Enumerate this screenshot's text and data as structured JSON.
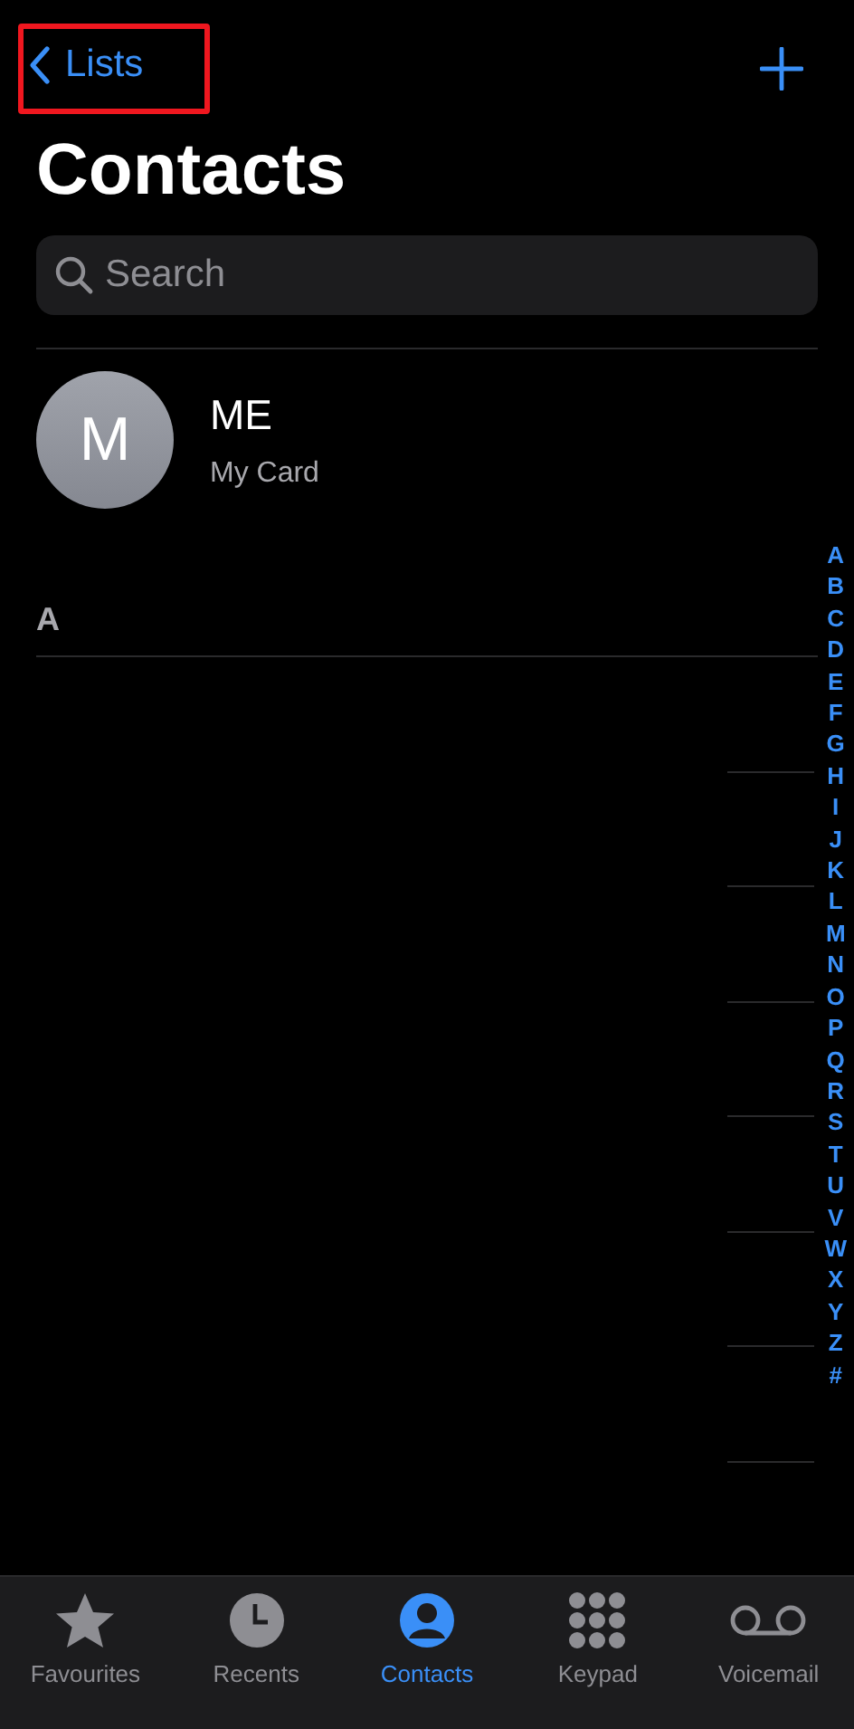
{
  "nav": {
    "back_label": "Lists"
  },
  "title": "Contacts",
  "search": {
    "placeholder": "Search"
  },
  "my_card": {
    "initial": "M",
    "name": "ME",
    "subtitle": "My Card"
  },
  "sections": [
    {
      "header": "A"
    }
  ],
  "index_letters": [
    "A",
    "B",
    "C",
    "D",
    "E",
    "F",
    "G",
    "H",
    "I",
    "J",
    "K",
    "L",
    "M",
    "N",
    "O",
    "P",
    "Q",
    "R",
    "S",
    "T",
    "U",
    "V",
    "W",
    "X",
    "Y",
    "Z",
    "#"
  ],
  "tabs": [
    {
      "label": "Favourites",
      "kind": "star",
      "selected": false
    },
    {
      "label": "Recents",
      "kind": "clock",
      "selected": false
    },
    {
      "label": "Contacts",
      "kind": "person",
      "selected": true
    },
    {
      "label": "Keypad",
      "kind": "keypad",
      "selected": false
    },
    {
      "label": "Voicemail",
      "kind": "voicemail",
      "selected": false
    }
  ]
}
